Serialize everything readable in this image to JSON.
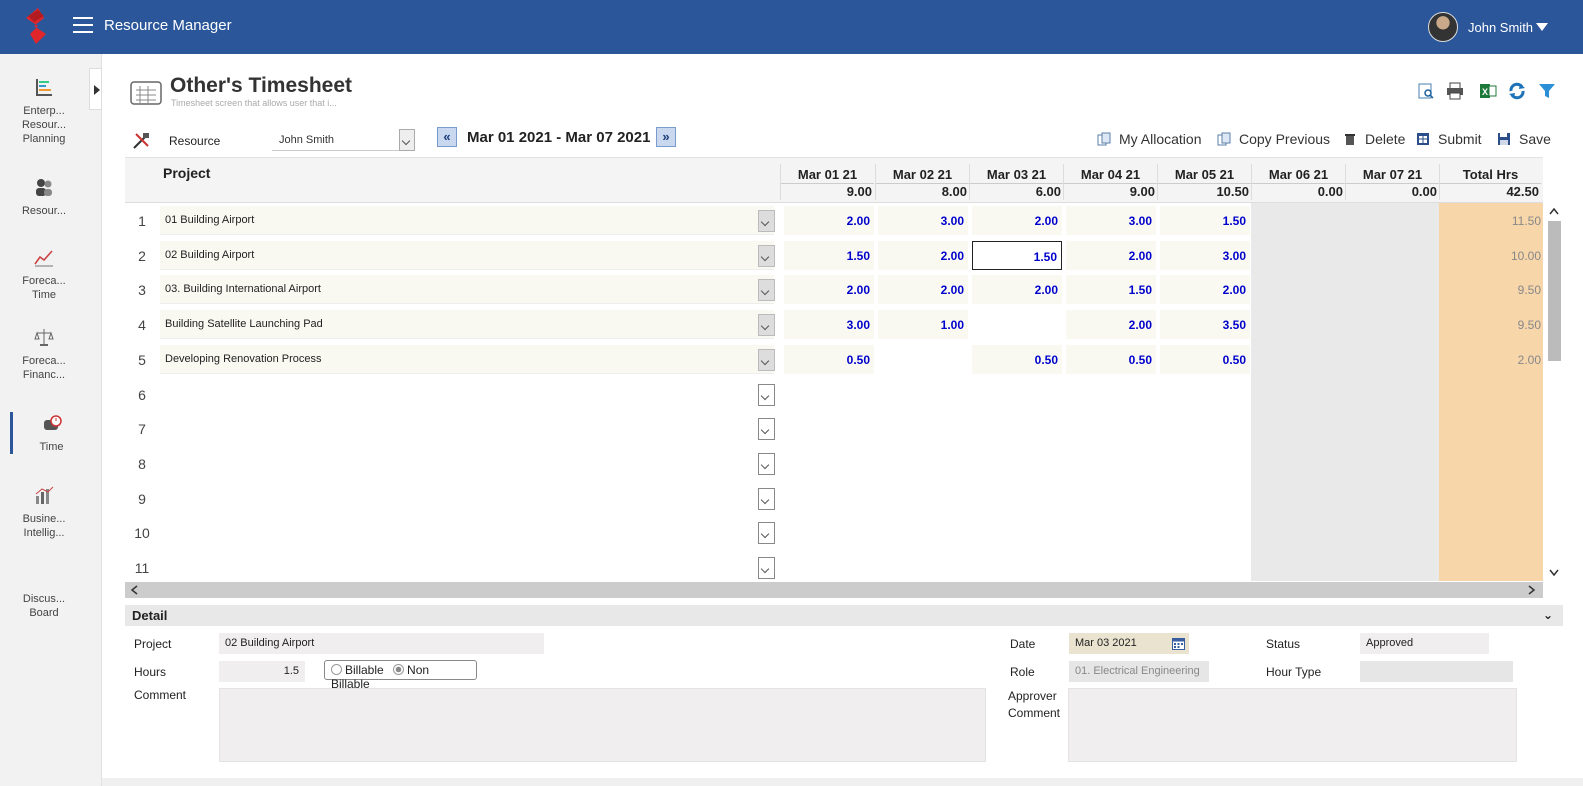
{
  "app": {
    "title": "Resource Manager",
    "user": "John Smith"
  },
  "sidebar": [
    {
      "label": "Enterp... Resour... Planning",
      "lines": [
        "Enterp...",
        "Resour...",
        "Planning"
      ],
      "icon": "gantt-icon"
    },
    {
      "label": "Resour...",
      "lines": [
        "Resour..."
      ],
      "icon": "people-icon"
    },
    {
      "label": "Foreca... Time",
      "lines": [
        "Foreca...",
        "Time"
      ],
      "icon": "line-chart-icon"
    },
    {
      "label": "Foreca... Financ...",
      "lines": [
        "Foreca...",
        "Financ..."
      ],
      "icon": "balance-icon"
    },
    {
      "label": "Time",
      "lines": [
        "Time"
      ],
      "icon": "clock-icon",
      "active": true
    },
    {
      "label": "Busine... Intellig...",
      "lines": [
        "Busine...",
        "Intellig..."
      ],
      "icon": "bar-chart-icon"
    },
    {
      "label": "Discus... Board",
      "lines": [
        "Discus...",
        "Board"
      ],
      "icon": ""
    }
  ],
  "page": {
    "title": "Other's Timesheet",
    "subtitle": "Timesheet screen that allows user that i..."
  },
  "resource": {
    "label": "Resource",
    "value": "John Smith"
  },
  "date_range": "Mar 01 2021 - Mar 07 2021",
  "actions": {
    "my_allocation": "My Allocation",
    "copy_previous": "Copy Previous",
    "delete": "Delete",
    "submit": "Submit",
    "save": "Save"
  },
  "grid": {
    "project_header": "Project",
    "columns": [
      {
        "date": "Mar 01 21",
        "total": "9.00"
      },
      {
        "date": "Mar 02 21",
        "total": "8.00"
      },
      {
        "date": "Mar 03 21",
        "total": "6.00"
      },
      {
        "date": "Mar 04 21",
        "total": "9.00"
      },
      {
        "date": "Mar 05 21",
        "total": "10.50"
      },
      {
        "date": "Mar 06 21",
        "total": "0.00"
      },
      {
        "date": "Mar 07 21",
        "total": "0.00"
      },
      {
        "date": "Total Hrs",
        "total": "42.50"
      }
    ],
    "rows": [
      {
        "num": "1",
        "project": "01 Building Airport",
        "hours": [
          "2.00",
          "3.00",
          "2.00",
          "3.00",
          "1.50"
        ],
        "total": "11.50"
      },
      {
        "num": "2",
        "project": "02 Building Airport",
        "hours": [
          "1.50",
          "2.00",
          "1.50",
          "2.00",
          "3.00"
        ],
        "total": "10.00"
      },
      {
        "num": "3",
        "project": "03. Building International Airport",
        "hours": [
          "2.00",
          "2.00",
          "2.00",
          "1.50",
          "2.00"
        ],
        "total": "9.50"
      },
      {
        "num": "4",
        "project": "Building Satellite Launching Pad",
        "hours": [
          "3.00",
          "1.00",
          "",
          "2.00",
          "3.50"
        ],
        "total": "9.50"
      },
      {
        "num": "5",
        "project": "Developing Renovation Process",
        "hours": [
          "0.50",
          "",
          "0.50",
          "0.50",
          "0.50"
        ],
        "total": "2.00"
      },
      {
        "num": "6",
        "project": "",
        "hours": [],
        "total": ""
      },
      {
        "num": "7",
        "project": "",
        "hours": [],
        "total": ""
      },
      {
        "num": "8",
        "project": "",
        "hours": [],
        "total": ""
      },
      {
        "num": "9",
        "project": "",
        "hours": [],
        "total": ""
      },
      {
        "num": "10",
        "project": "",
        "hours": [],
        "total": ""
      },
      {
        "num": "11",
        "project": "",
        "hours": [],
        "total": ""
      }
    ]
  },
  "detail": {
    "header": "Detail",
    "project_label": "Project",
    "project_value": "02 Building Airport",
    "hours_label": "Hours",
    "hours_value": "1.5",
    "billable": "Billable",
    "non_billable": "Non Billable",
    "comment_label": "Comment",
    "date_label": "Date",
    "date_value": "Mar 03 2021",
    "role_label": "Role",
    "role_value": "01. Electrical Engineering",
    "approver_label_1": "Approver",
    "approver_label_2": "Comment",
    "status_label": "Status",
    "status_value": "Approved",
    "hour_type_label": "Hour Type",
    "hour_type_value": ""
  },
  "colors": {
    "topbar": "#2b579a",
    "hours_text": "#0000cc",
    "total_col": "#f7d6aa"
  }
}
